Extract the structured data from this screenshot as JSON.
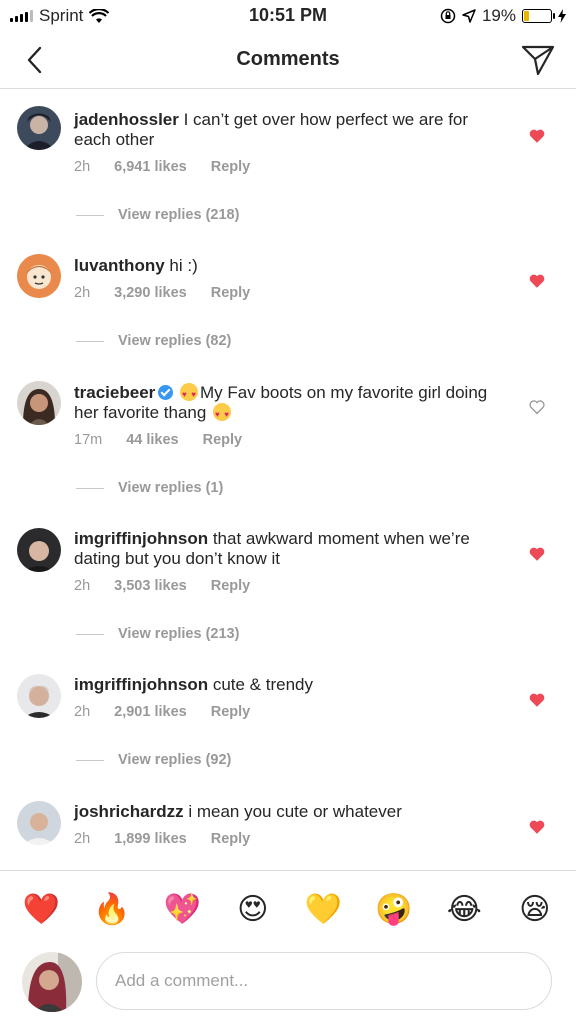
{
  "status_bar": {
    "carrier": "Sprint",
    "time": "10:51 PM",
    "battery": "19%",
    "battery_level": 0.19
  },
  "header": {
    "title": "Comments",
    "back_icon": "chevron-left-icon",
    "share_icon": "paper-plane-icon"
  },
  "comments": [
    {
      "user": "jadenhossler",
      "text": "I can’t get over how perfect we are for each other",
      "time": "2h",
      "likes": "6,941 likes",
      "reply": "Reply",
      "replies": "View replies (218)",
      "liked": true
    },
    {
      "user": "luvanthony",
      "text": "hi :)",
      "time": "2h",
      "likes": "3,290 likes",
      "reply": "Reply",
      "replies": "View replies (82)",
      "liked": true
    },
    {
      "user": "traciebeer",
      "text_a": "My Fav boots on my favorite girl doing her favorite thang",
      "time": "17m",
      "likes": "44 likes",
      "reply": "Reply",
      "replies": "View replies (1)",
      "liked": false,
      "verified": true
    },
    {
      "user": "imgriffinjohnson",
      "text": "that awkward moment when we’re dating but you don’t know it",
      "time": "2h",
      "likes": "3,503 likes",
      "reply": "Reply",
      "replies": "View replies (213)",
      "liked": true
    },
    {
      "user": "imgriffinjohnson",
      "text": "cute & trendy",
      "time": "2h",
      "likes": "2,901 likes",
      "reply": "Reply",
      "replies": "View replies (92)",
      "liked": true
    },
    {
      "user": "joshrichardzz",
      "text": "i mean you cute or whatever",
      "time": "2h",
      "likes": "1,899 likes",
      "reply": "Reply",
      "liked": true
    }
  ],
  "emoji_bar": [
    "❤️",
    "🔥",
    "💖",
    "😍",
    "💛",
    "🤪",
    "😂",
    "😪"
  ],
  "input": {
    "placeholder": "Add a comment..."
  },
  "colors": {
    "heart_red": "#ed4956",
    "muted": "#999999",
    "text": "#262626",
    "border": "#dbdbdb"
  }
}
